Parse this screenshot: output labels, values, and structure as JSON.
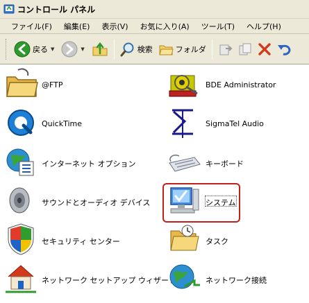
{
  "window": {
    "title": "コントロール パネル"
  },
  "menu": [
    {
      "label": "ファイル(F)"
    },
    {
      "label": "編集(E)"
    },
    {
      "label": "表示(V)"
    },
    {
      "label": "お気に入り(A)"
    },
    {
      "label": "ツール(T)"
    },
    {
      "label": "ヘルプ(H)"
    }
  ],
  "toolbar": {
    "back_label": "戻る",
    "search_label": "検索",
    "folders_label": "フォルダ"
  },
  "items": [
    {
      "label": "@FTP",
      "icon": "folder-icon"
    },
    {
      "label": "BDE Administrator",
      "icon": "bde-gear-icon"
    },
    {
      "label": "QuickTime",
      "icon": "quicktime-icon"
    },
    {
      "label": "SigmaTel Audio",
      "icon": "sigmatel-icon"
    },
    {
      "label": "インターネット オプション",
      "icon": "internet-options-icon"
    },
    {
      "label": "キーボード",
      "icon": "keyboard-icon"
    },
    {
      "label": "サウンドとオーディオ デバイス",
      "icon": "speaker-icon"
    },
    {
      "label": "システム",
      "icon": "system-computer-icon"
    },
    {
      "label": "セキュリティ センター",
      "icon": "shield-icon"
    },
    {
      "label": "タスク",
      "icon": "task-folder-icon"
    },
    {
      "label": "ネットワーク セットアップ ウィザード",
      "icon": "network-setup-icon"
    },
    {
      "label": "ネットワーク接続",
      "icon": "network-connections-icon"
    }
  ],
  "colors": {
    "highlight": "#c0201a",
    "chrome": "#ece9d8"
  }
}
